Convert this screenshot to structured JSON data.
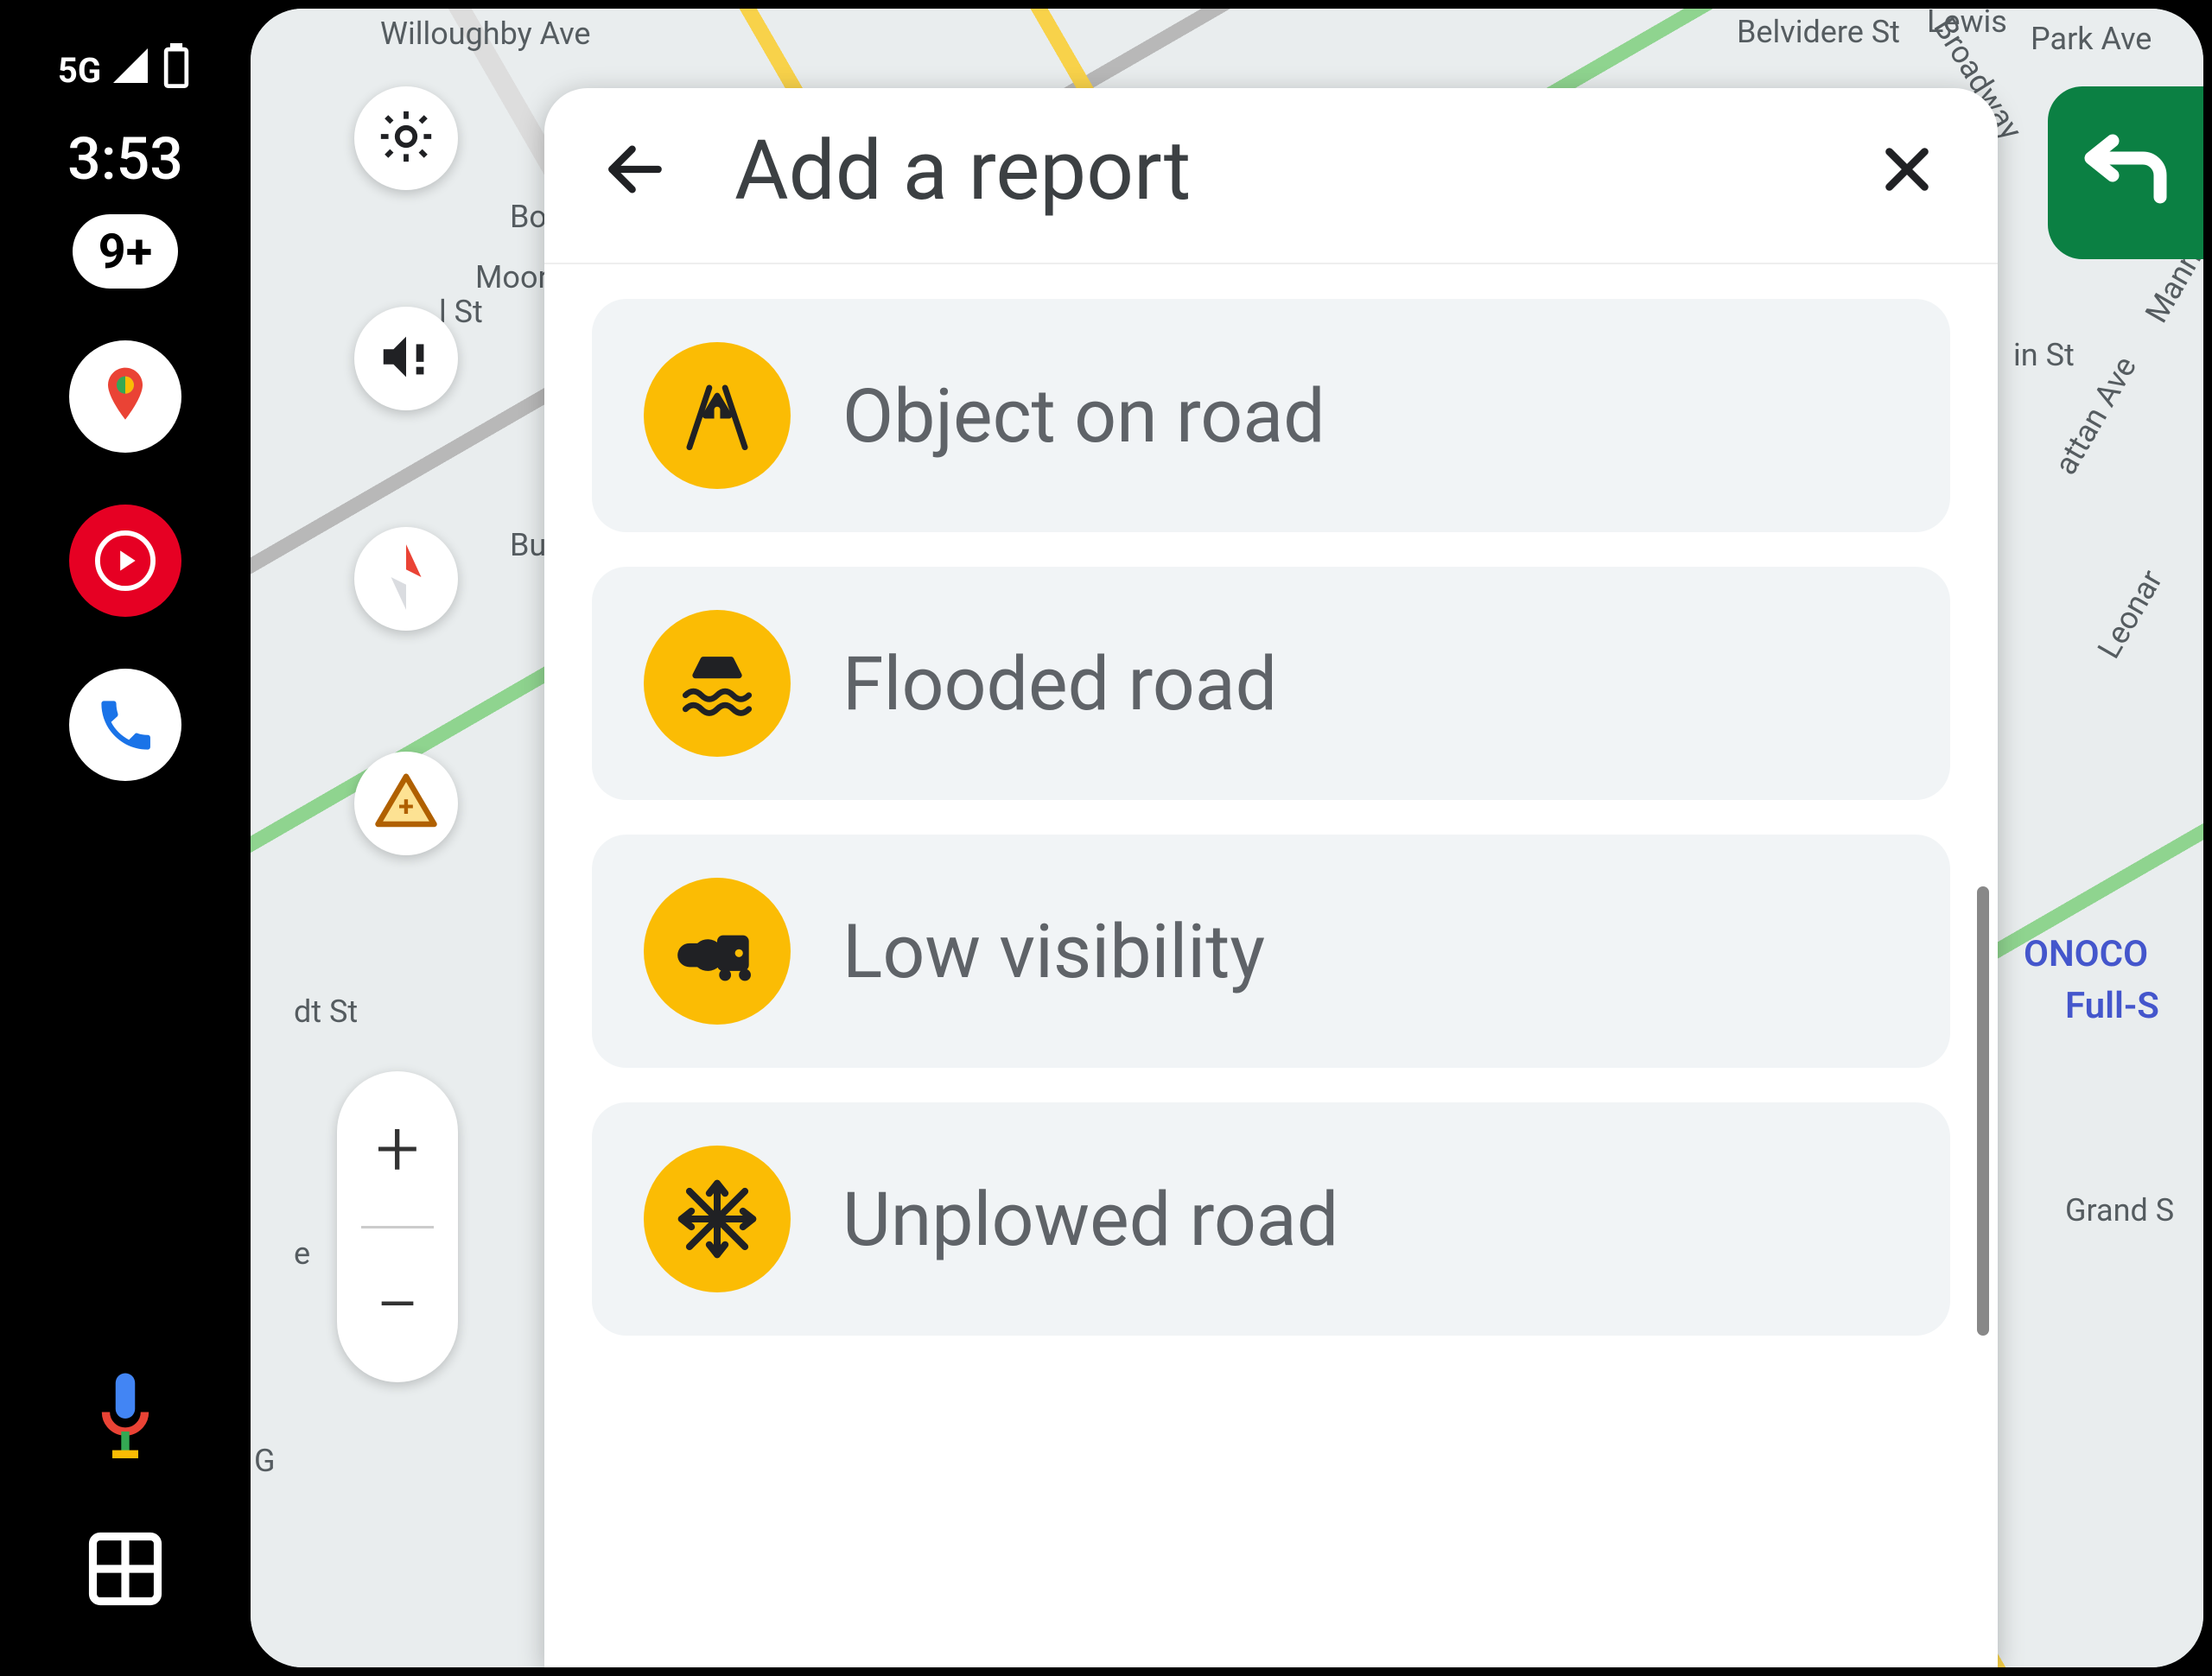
{
  "status": {
    "network": "5G",
    "clock": "3:53",
    "notification_count": "9+"
  },
  "dock": {
    "apps": [
      "maps",
      "music",
      "phone"
    ]
  },
  "map": {
    "streets": {
      "willoughby": "Willoughby Ave",
      "belvidere": "Belvidere St",
      "park": "Park Ave",
      "broadway": "Broadway",
      "boga": "Bogart",
      "moor": "Moor",
      "lst": "l St",
      "bu": "Bu",
      "dt": "dt St",
      "e": "e",
      "g": "G",
      "in": "in St",
      "attan": "attan Ave",
      "leonar": "Leonar",
      "grand": "Grand S",
      "mann": "Mann",
      "lewis": "Lewis"
    },
    "poi": {
      "onoco1": "ONOCO",
      "onoco2": "Full-S"
    }
  },
  "panel": {
    "title": "Add a report",
    "items": [
      {
        "id": "object-on-road",
        "label": "Object on road"
      },
      {
        "id": "flooded-road",
        "label": "Flooded road"
      },
      {
        "id": "low-visibility",
        "label": "Low visibility"
      },
      {
        "id": "unplowed-road",
        "label": "Unplowed road"
      }
    ]
  },
  "colors": {
    "hazard": "#fbbc04",
    "nav_green": "#0b8043"
  }
}
